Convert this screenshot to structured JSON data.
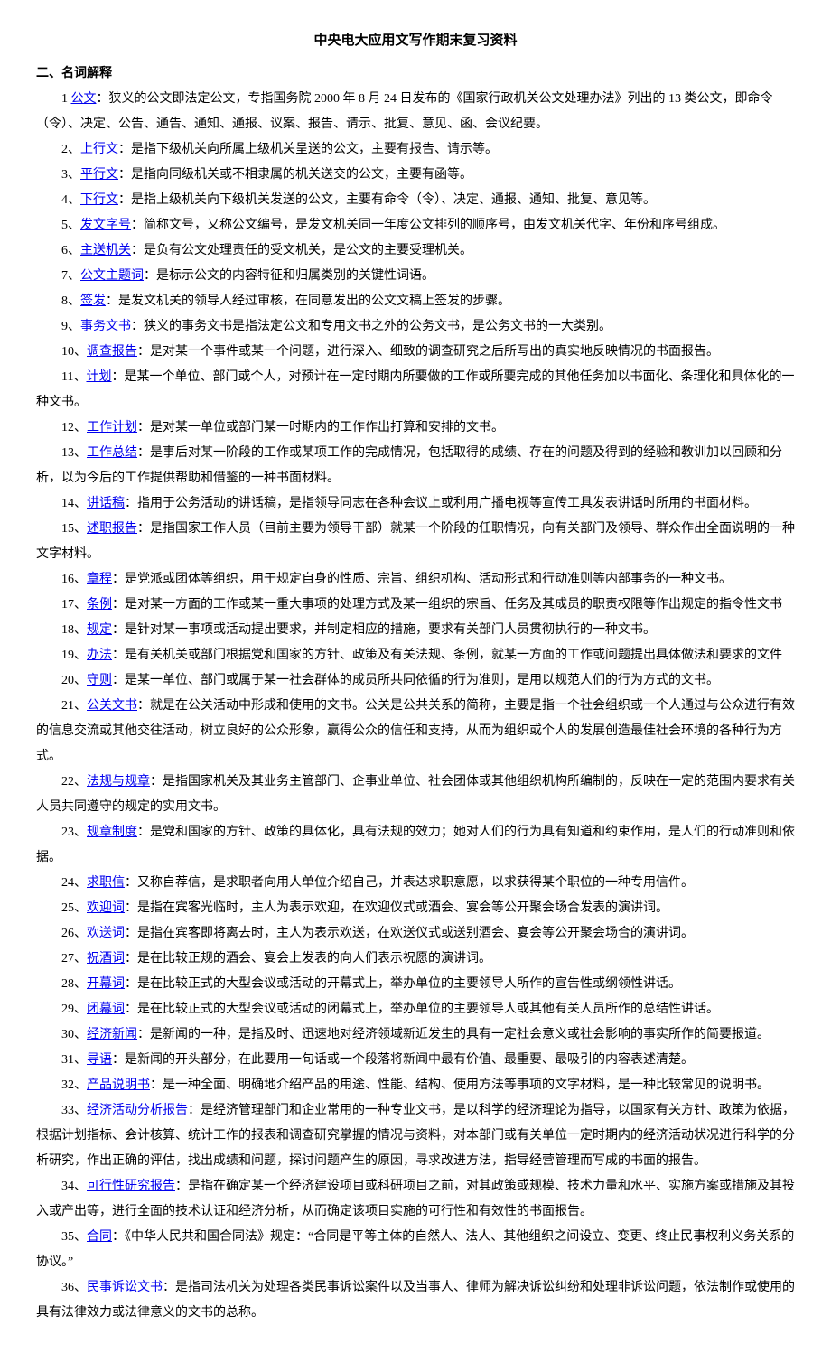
{
  "title": "中央电大应用文写作期末复习资料",
  "section_heading": "二、名词解释",
  "entries": [
    {
      "num": "1",
      "sep": "",
      "term": "公文",
      "def": "：狭义的公文即法定公文，专指国务院 2000 年 8 月 24 日发布的《国家行政机关公文处理办法》列出的 13 类公文，即命令（令）、决定、公告、通告、通知、通报、议案、报告、请示、批复、意见、函、会议纪要。"
    },
    {
      "num": "2",
      "sep": "、",
      "term": "上行文",
      "def": "：是指下级机关向所属上级机关呈送的公文，主要有报告、请示等。"
    },
    {
      "num": "3",
      "sep": "、",
      "term": "平行文",
      "def": "：是指向同级机关或不相隶属的机关送交的公文，主要有函等。"
    },
    {
      "num": "4",
      "sep": "、",
      "term": "下行文",
      "def": "：是指上级机关向下级机关发送的公文，主要有命令（令）、决定、通报、通知、批复、意见等。"
    },
    {
      "num": "5",
      "sep": "、",
      "term": "发文字号",
      "def": "：简称文号，又称公文编号，是发文机关同一年度公文排列的顺序号，由发文机关代字、年份和序号组成。"
    },
    {
      "num": "6",
      "sep": "、",
      "term": "主送机关",
      "def": "：是负有公文处理责任的受文机关，是公文的主要受理机关。"
    },
    {
      "num": "7",
      "sep": "、",
      "term": "公文主题词",
      "def": "：是标示公文的内容特征和归属类别的关键性词语。"
    },
    {
      "num": "8",
      "sep": "、",
      "term": "签发",
      "def": "：是发文机关的领导人经过审核，在同意发出的公文文稿上签发的步骤。"
    },
    {
      "num": "9",
      "sep": "、",
      "term": "事务文书",
      "def": "：狭义的事务文书是指法定公文和专用文书之外的公务文书，是公务文书的一大类别。"
    },
    {
      "num": "10",
      "sep": "、",
      "term": "调查报告",
      "def": "：是对某一个事件或某一个问题，进行深入、细致的调查研究之后所写出的真实地反映情况的书面报告。"
    },
    {
      "num": "11",
      "sep": "、",
      "term": "计划",
      "def": "：是某一个单位、部门或个人，对预计在一定时期内所要做的工作或所要完成的其他任务加以书面化、条理化和具体化的一种文书。"
    },
    {
      "num": "12",
      "sep": "、",
      "term": "工作计划",
      "def": "：是对某一单位或部门某一时期内的工作作出打算和安排的文书。"
    },
    {
      "num": "13",
      "sep": "、",
      "term": "工作总结",
      "def": "：是事后对某一阶段的工作或某项工作的完成情况，包括取得的成绩、存在的问题及得到的经验和教训加以回顾和分析，以为今后的工作提供帮助和借鉴的一种书面材料。"
    },
    {
      "num": "14",
      "sep": "、",
      "term": "讲话稿",
      "def": "：指用于公务活动的讲话稿，是指领导同志在各种会议上或利用广播电视等宣传工具发表讲话时所用的书面材料。"
    },
    {
      "num": "15",
      "sep": "、",
      "term": "述职报告",
      "def": "：是指国家工作人员（目前主要为领导干部）就某一个阶段的任职情况，向有关部门及领导、群众作出全面说明的一种文字材料。"
    },
    {
      "num": "16",
      "sep": "、",
      "term": "章程",
      "def": "：是党派或团体等组织，用于规定自身的性质、宗旨、组织机构、活动形式和行动准则等内部事务的一种文书。"
    },
    {
      "num": "17",
      "sep": "、",
      "term": "条例",
      "def": "：是对某一方面的工作或某一重大事项的处理方式及某一组织的宗旨、任务及其成员的职责权限等作出规定的指令性文书"
    },
    {
      "num": "18",
      "sep": "、",
      "term": "规定",
      "def": "：是针对某一事项或活动提出要求，并制定相应的措施，要求有关部门人员贯彻执行的一种文书。"
    },
    {
      "num": "19",
      "sep": "、",
      "term": "办法",
      "def": "：是有关机关或部门根据党和国家的方针、政策及有关法规、条例，就某一方面的工作或问题提出具体做法和要求的文件"
    },
    {
      "num": "20",
      "sep": "、",
      "term": "守则",
      "def": "：是某一单位、部门或属于某一社会群体的成员所共同依循的行为准则，是用以规范人们的行为方式的文书。"
    },
    {
      "num": "21",
      "sep": "、",
      "term": "公关文书",
      "def": "：就是在公关活动中形成和使用的文书。公关是公共关系的简称，主要是指一个社会组织或一个人通过与公众进行有效的信息交流或其他交往活动，树立良好的公众形象，赢得公众的信任和支持，从而为组织或个人的发展创造最佳社会环境的各种行为方式。"
    },
    {
      "num": "22",
      "sep": "、",
      "term": "法规与规章",
      "def": "：是指国家机关及其业务主管部门、企事业单位、社会团体或其他组织机构所编制的，反映在一定的范围内要求有关人员共同遵守的规定的实用文书。"
    },
    {
      "num": "23",
      "sep": "、",
      "term": "规章制度",
      "def": "：是党和国家的方针、政策的具体化，具有法规的效力；她对人们的行为具有知道和约束作用，是人们的行动准则和依据。"
    },
    {
      "num": "24",
      "sep": "、",
      "term": "求职信",
      "def": "：又称自荐信，是求职者向用人单位介绍自己，并表达求职意愿，以求获得某个职位的一种专用信件。"
    },
    {
      "num": "25",
      "sep": "、",
      "term": "欢迎词",
      "def": "：是指在宾客光临时，主人为表示欢迎，在欢迎仪式或酒会、宴会等公开聚会场合发表的演讲词。"
    },
    {
      "num": "26",
      "sep": "、",
      "term": "欢送词",
      "def": "：是指在宾客即将离去时，主人为表示欢送，在欢送仪式或送别酒会、宴会等公开聚会场合的演讲词。"
    },
    {
      "num": "27",
      "sep": "、",
      "term": "祝酒词",
      "def": "：是在比较正规的酒会、宴会上发表的向人们表示祝愿的演讲词。"
    },
    {
      "num": "28",
      "sep": "、",
      "term": "开幕词",
      "def": "：是在比较正式的大型会议或活动的开幕式上，举办单位的主要领导人所作的宣告性或纲领性讲话。"
    },
    {
      "num": "29",
      "sep": "、",
      "term": "闭幕词",
      "def": "：是在比较正式的大型会议或活动的闭幕式上，举办单位的主要领导人或其他有关人员所作的总结性讲话。"
    },
    {
      "num": "30",
      "sep": "、",
      "term": "经济新闻",
      "def": "：是新闻的一种，是指及时、迅速地对经济领域新近发生的具有一定社会意义或社会影响的事实所作的简要报道。"
    },
    {
      "num": "31",
      "sep": "、",
      "term": "导语",
      "def": "：是新闻的开头部分，在此要用一句话或一个段落将新闻中最有价值、最重要、最吸引的内容表述清楚。"
    },
    {
      "num": "32",
      "sep": "、",
      "term": "产品说明书",
      "def": "：是一种全面、明确地介绍产品的用途、性能、结构、使用方法等事项的文字材料，是一种比较常见的说明书。"
    },
    {
      "num": "33",
      "sep": "、",
      "term": "经济活动分析报告",
      "def": "：是经济管理部门和企业常用的一种专业文书，是以科学的经济理论为指导，以国家有关方针、政策为依据，根据计划指标、会计核算、统计工作的报表和调查研究掌握的情况与资料，对本部门或有关单位一定时期内的经济活动状况进行科学的分析研究，作出正确的评估，找出成绩和问题，探讨问题产生的原因，寻求改进方法，指导经营管理而写成的书面的报告。"
    },
    {
      "num": "34",
      "sep": "、",
      "term": "可行性研究报告",
      "def": "：是指在确定某一个经济建设项目或科研项目之前，对其政策或规模、技术力量和水平、实施方案或措施及其投入或产出等，进行全面的技术认证和经济分析，从而确定该项目实施的可行性和有效性的书面报告。"
    },
    {
      "num": "35",
      "sep": "、",
      "term": "合同",
      "def": "：《中华人民共和国合同法》规定：“合同是平等主体的自然人、法人、其他组织之间设立、变更、终止民事权利义务关系的协议。”"
    },
    {
      "num": "36",
      "sep": "、",
      "term": "民事诉讼文书",
      "def": "：是指司法机关为处理各类民事诉讼案件以及当事人、律师为解决诉讼纠纷和处理非诉讼问题，依法制作或使用的具有法律效力或法律意义的文书的总称。"
    }
  ]
}
